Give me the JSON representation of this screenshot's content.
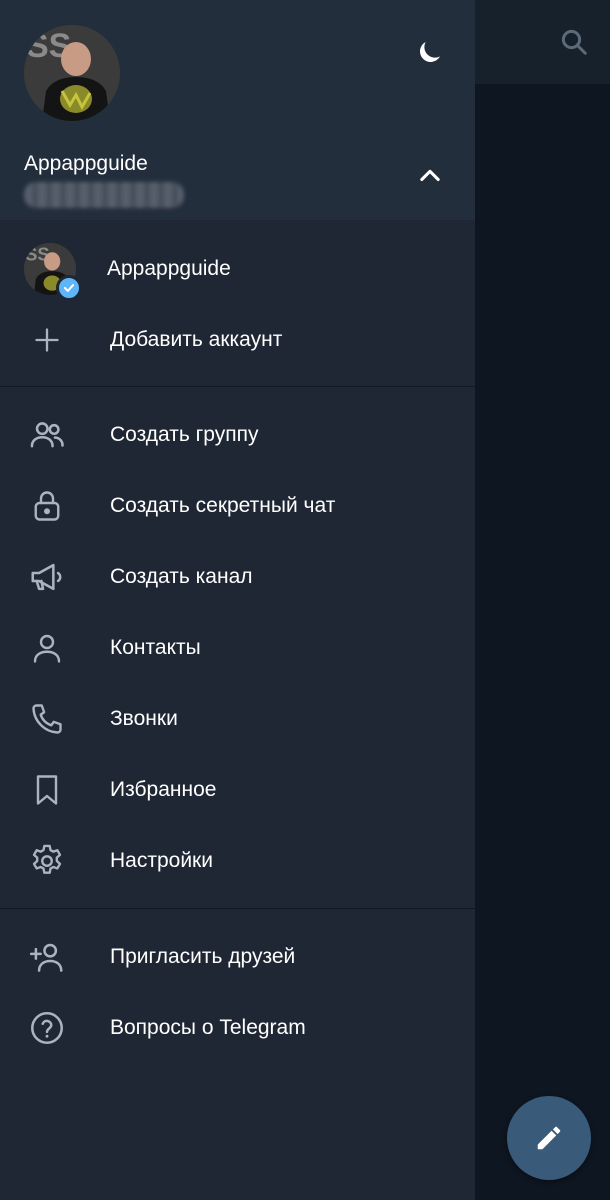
{
  "profile": {
    "name": "Appappguide",
    "avatar_icon": "profile-avatar"
  },
  "accounts": {
    "current_name": "Appappguide",
    "add_account_label": "Добавить аккаунт"
  },
  "menu": {
    "items": [
      {
        "label": "Создать группу",
        "icon": "group-icon"
      },
      {
        "label": "Создать секретный чат",
        "icon": "lock-icon"
      },
      {
        "label": "Создать канал",
        "icon": "megaphone-icon"
      },
      {
        "label": "Контакты",
        "icon": "person-icon"
      },
      {
        "label": "Звонки",
        "icon": "phone-icon"
      },
      {
        "label": "Избранное",
        "icon": "bookmark-icon"
      },
      {
        "label": "Настройки",
        "icon": "gear-icon"
      }
    ],
    "extra": [
      {
        "label": "Пригласить друзей",
        "icon": "add-person-icon"
      },
      {
        "label": "Вопросы о Telegram",
        "icon": "question-icon"
      }
    ]
  },
  "colors": {
    "drawer_bg": "#1e2733",
    "header_bg": "#232e3c",
    "accent": "#5eb5f7",
    "icon": "#aab4be"
  }
}
